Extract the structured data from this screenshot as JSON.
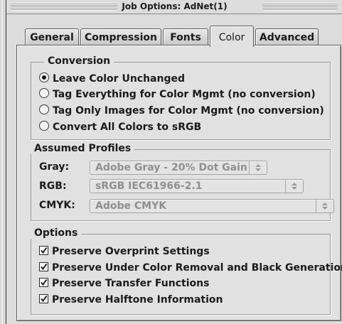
{
  "window": {
    "title": "Job Options: AdNet(1)"
  },
  "tabs": [
    {
      "label": "General"
    },
    {
      "label": "Compression"
    },
    {
      "label": "Fonts"
    },
    {
      "label": "Color"
    },
    {
      "label": "Advanced"
    }
  ],
  "active_tab": "Color",
  "conversion": {
    "label": "Conversion",
    "options": [
      {
        "label": "Leave Color Unchanged",
        "selected": true
      },
      {
        "label": "Tag Everything for Color Mgmt (no conversion)",
        "selected": false
      },
      {
        "label": "Tag Only Images for Color Mgmt (no conversion)",
        "selected": false
      },
      {
        "label": "Convert All Colors to sRGB",
        "selected": false
      }
    ]
  },
  "profiles": {
    "label": "Assumed Profiles",
    "gray": {
      "label": "Gray:",
      "value": "Adobe Gray - 20% Dot Gain"
    },
    "rgb": {
      "label": "RGB:",
      "value": "sRGB IEC61966-2.1"
    },
    "cmyk": {
      "label": "CMYK:",
      "value": "Adobe CMYK"
    }
  },
  "options": {
    "label": "Options",
    "items": [
      {
        "label": "Preserve Overprint Settings",
        "checked": true
      },
      {
        "label": "Preserve Under Color Removal and Black Generation",
        "checked": true
      },
      {
        "label": "Preserve Transfer Functions",
        "checked": true
      },
      {
        "label": "Preserve Halftone Information",
        "checked": true
      }
    ]
  }
}
